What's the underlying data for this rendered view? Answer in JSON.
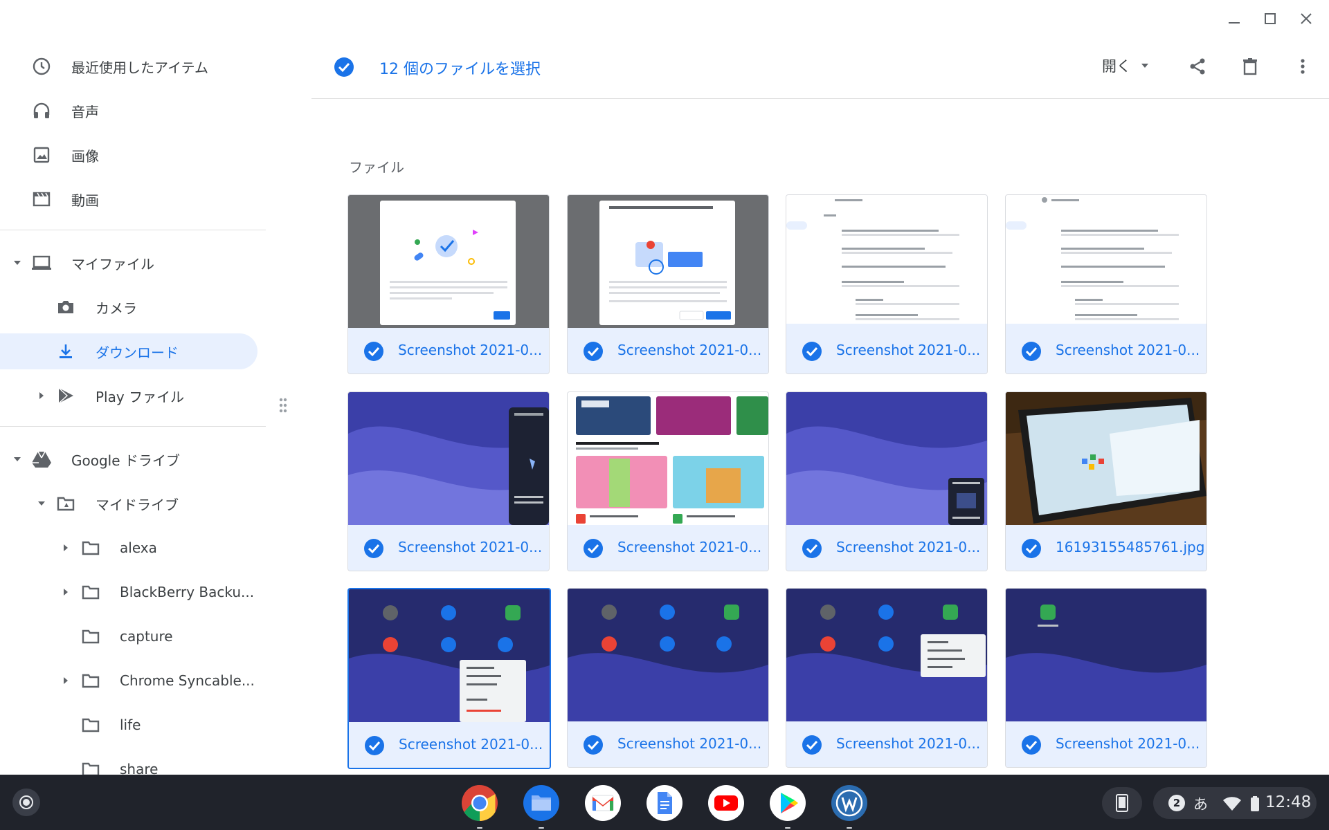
{
  "sidebar": {
    "recent": "最近使用したアイテム",
    "audio": "音声",
    "images": "画像",
    "videos": "動画",
    "my_files": "マイファイル",
    "camera": "カメラ",
    "downloads": "ダウンロード",
    "play_files": "Play ファイル",
    "google_drive": "Google ドライブ",
    "my_drive": "マイドライブ",
    "folders": [
      "alexa",
      "BlackBerry Backu...",
      "capture",
      "Chrome Syncable...",
      "life",
      "share"
    ]
  },
  "header": {
    "selection": "12 個のファイルを選択",
    "open_label": "開く"
  },
  "section_title": "ファイル",
  "files": [
    {
      "name": "Screenshot 2021-0...",
      "thumb": "dialog-light"
    },
    {
      "name": "Screenshot 2021-0...",
      "thumb": "dialog-light"
    },
    {
      "name": "Screenshot 2021-0...",
      "thumb": "settings"
    },
    {
      "name": "Screenshot 2021-0...",
      "thumb": "settings"
    },
    {
      "name": "Screenshot 2021-0...",
      "thumb": "wallpaper-panel"
    },
    {
      "name": "Screenshot 2021-0...",
      "thumb": "store"
    },
    {
      "name": "Screenshot 2021-0...",
      "thumb": "wallpaper-popup"
    },
    {
      "name": "16193155485761.jpg",
      "thumb": "photo"
    },
    {
      "name": "Screenshot 2021-0...",
      "thumb": "desktop-menu"
    },
    {
      "name": "Screenshot 2021-0...",
      "thumb": "desktop"
    },
    {
      "name": "Screenshot 2021-0...",
      "thumb": "desktop-menu2"
    },
    {
      "name": "Screenshot 2021-0...",
      "thumb": "desktop-single"
    }
  ],
  "shelf": {
    "apps": [
      "chrome",
      "files",
      "gmail",
      "docs",
      "youtube",
      "play-store",
      "wordpress"
    ],
    "notification_count": "2",
    "ime": "あ",
    "time": "12:48"
  },
  "colors": {
    "accent": "#1a73e8",
    "selected_bg": "#e8f0fe",
    "shelf_bg": "#20232b"
  }
}
